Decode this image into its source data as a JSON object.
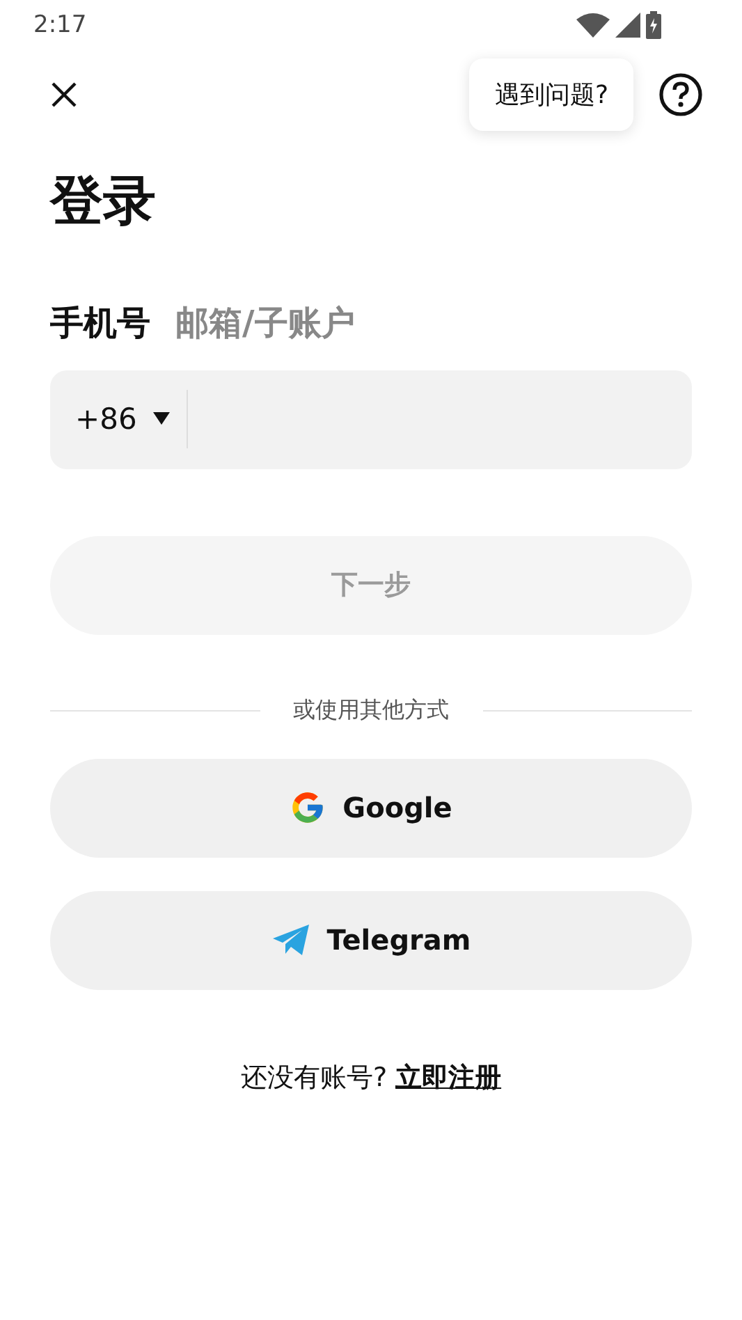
{
  "status_bar": {
    "time": "2:17"
  },
  "help_tooltip": {
    "text": "遇到问题?"
  },
  "title": "登录",
  "tabs": [
    {
      "label": "手机号",
      "selected": true
    },
    {
      "label": "邮箱/子账户",
      "selected": false
    }
  ],
  "phone_field": {
    "country_code": "+86"
  },
  "next_button": {
    "label": "下一步",
    "disabled": true
  },
  "divider_text": "或使用其他方式",
  "social_buttons": [
    {
      "kind": "google",
      "label": "Google"
    },
    {
      "kind": "telegram",
      "label": "Telegram"
    }
  ],
  "register": {
    "prompt": "还没有账号?",
    "link": "立即注册"
  }
}
